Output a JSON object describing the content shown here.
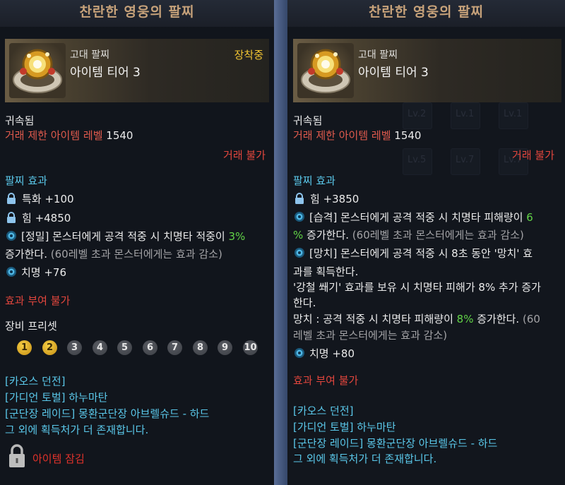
{
  "left": {
    "title": "찬란한 영웅의 팔찌",
    "grade": "고대 팔찌",
    "tier": "아이템 티어 3",
    "equipped": "장착중",
    "bound": "귀속됨",
    "trade_label": "거래 제한 아이템 레벨",
    "trade_level": "1540",
    "no_trade": "거래 불가",
    "effects_title": "팔찌 효과",
    "stat1": "특화 +100",
    "stat2": "힘 +4850",
    "effect_line1_a": "[정밀] 몬스터에게 공격 적중 시 치명타 적중이",
    "effect_line1_b": "3%",
    "effect_line2_a": "증가한다.",
    "effect_line2_b": "(60레벨 초과 몬스터에게는 효과 감소)",
    "stat3": "치명 +76",
    "no_grant": "효과 부여 불가",
    "preset_title": "장비 프리셋",
    "presets": [
      "1",
      "2",
      "3",
      "4",
      "5",
      "6",
      "7",
      "8",
      "9",
      "10"
    ],
    "sources": [
      "[카오스 던전]",
      "[가디언 토벌] 하누마탄",
      "[군단장 레이드] 몽환군단장 아브렐슈드 - 하드",
      "그 외에 획득처가 더 존재합니다."
    ],
    "item_lock": "아이템 잠김"
  },
  "right": {
    "title": "찬란한 영웅의 팔찌",
    "grade": "고대 팔찌",
    "tier": "아이템 티어 3",
    "bound": "귀속됨",
    "trade_label": "거래 제한 아이템 레벨",
    "trade_level": "1540",
    "no_trade": "거래 불가",
    "effects_title": "팔찌 효과",
    "stat1": "힘 +3850",
    "raid_a": "[습격] 몬스터에게 공격 적중 시 치명타 피해량이",
    "raid_b": "6",
    "raid_c": "%",
    "raid_d": "증가한다.",
    "raid_e": "(60레벨 초과 몬스터에게는 효과 감소)",
    "hammer_1": "[망치] 몬스터에게 공격 적중 시 8초 동안 '망치' 효",
    "hammer_2": "과를 획득한다.",
    "hammer_3": "'강철 쐐기' 효과를 보유 시 치명타 피해가 8% 추가 증가",
    "hammer_4": "한다.",
    "hammer_5a": "망치 : 공격 적중 시 치명타 피해량이",
    "hammer_5b": "8%",
    "hammer_5c": "증가한다.",
    "hammer_5d": "(60",
    "hammer_6": "레벨 초과 몬스터에게는 효과 감소)",
    "stat3": "치명 +80",
    "no_grant": "효과 부여 불가",
    "sources": [
      "[카오스 던전]",
      "[가디언 토벌] 하누마탄",
      "[군단장 레이드] 몽환군단장 아브렐슈드 - 하드",
      "그 외에 획득처가 더 존재합니다."
    ],
    "bg_labels": [
      "24",
      "48",
      "Lv.2",
      "Lv.1",
      "Lv.1",
      "Lv.5",
      "Lv.7",
      "Lv.7"
    ]
  },
  "colors": {
    "title": "#c7a27a",
    "equipped": "#f0c332",
    "red": "#e2463d",
    "green": "#62d447",
    "cyan": "#5ac8ea",
    "preset_active": "#f0b82a"
  },
  "icons": [
    "padlock-icon",
    "lock-icon",
    "gem-icon",
    "bracelet-icon"
  ]
}
